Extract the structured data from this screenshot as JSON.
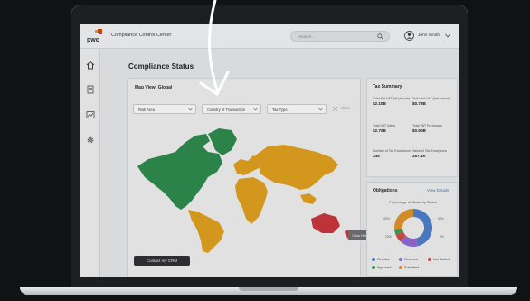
{
  "app": {
    "title": "Compliance Control Center",
    "logo_text": "pwc"
  },
  "header": {
    "search_placeholder": "Search...",
    "user_name": "John Smith"
  },
  "sidebar": {
    "items": [
      {
        "icon": "home-icon"
      },
      {
        "icon": "document-icon"
      },
      {
        "icon": "chart-icon"
      },
      {
        "icon": "gear-icon"
      }
    ]
  },
  "main": {
    "page_title": "Compliance Status",
    "map": {
      "title": "Map View: Global",
      "filters": [
        {
          "label": "Risk Area"
        },
        {
          "label": "Country of Transaction"
        },
        {
          "label": "Tax Type"
        }
      ],
      "clear_label": "Clear",
      "tooltip": "Click Here",
      "contact_button": "Contact my CRM",
      "colors": {
        "green": "#2e8b4e",
        "orange": "#e0a01f",
        "red": "#c9363d"
      }
    }
  },
  "tax_summary": {
    "title": "Tax Summary",
    "cells": [
      {
        "label": "Total Net VAT (all periods)",
        "value": "$2.10B"
      },
      {
        "label": "Total Net VAT (last period)",
        "value": "$0.78B"
      },
      {
        "label": "Total VAT Sales",
        "value": "$2.70B"
      },
      {
        "label": "Total VAT Purchases",
        "value": "$0.60B"
      },
      {
        "label": "Number of Tax Exceptions",
        "value": "245"
      },
      {
        "label": "Value of Tax Exceptions",
        "value": "287.1K"
      }
    ]
  },
  "obligations": {
    "title": "Obligations",
    "view_details": "View Details",
    "chart_caption": "Percentage of Status by Status",
    "legend": [
      {
        "label": "Overdue",
        "color": "#4e7fc9"
      },
      {
        "label": "Received",
        "color": "#8e6bd1"
      },
      {
        "label": "Not Started",
        "color": "#d04b44"
      },
      {
        "label": "Approved",
        "color": "#3f9a55"
      },
      {
        "label": "Submitted",
        "color": "#e0922a"
      }
    ]
  },
  "chart_data": {
    "type": "pie",
    "title": "Percentage of Status by Status",
    "categories": [
      "Overdue",
      "Received",
      "Not Started",
      "Approved",
      "Submitted"
    ],
    "values": [
      46,
      16,
      7,
      5,
      26
    ],
    "colors": [
      "#4e7fc9",
      "#8e6bd1",
      "#d04b44",
      "#3f9a55",
      "#e0922a"
    ],
    "tick_labels": [
      "40%",
      "60%",
      "20%",
      "0%"
    ]
  }
}
